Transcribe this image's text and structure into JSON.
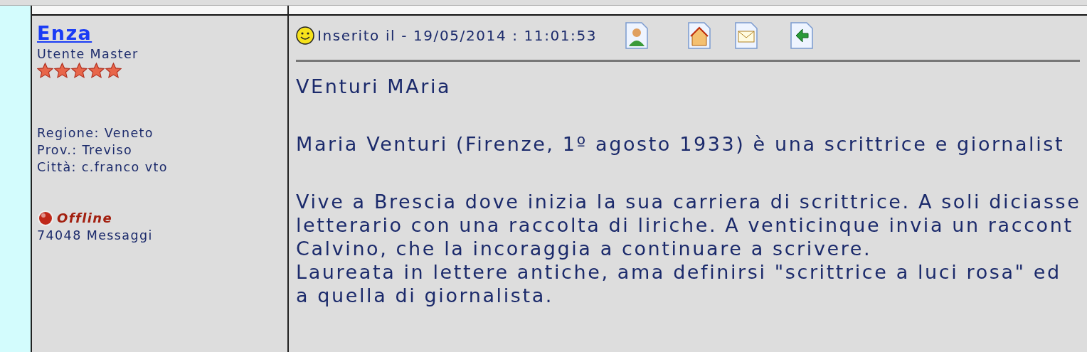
{
  "author": {
    "name": "Enza",
    "rank": "Utente Master",
    "stars": 5,
    "region": "Regione: Veneto",
    "province": "Prov.: Treviso",
    "city": "Città: c.franco vto",
    "status": {
      "label": "Offline",
      "online": false
    },
    "posts": "74048 Messaggi"
  },
  "post": {
    "posted": "Inserito il - 19/05/2014 : 11:01:53",
    "paragraphs": [
      [
        "VEnturi MAria"
      ],
      [
        "Maria Venturi (Firenze, 1º agosto 1933) è una scrittrice e giornalist"
      ],
      [
        "Vive a Brescia dove inizia la sua carriera di scrittrice. A soli diciasse",
        "letterario con una raccolta di liriche. A venticinque invia un raccont",
        "Calvino, che la incoraggia a continuare a scrivere.",
        "Laureata in lettere antiche, ama definirsi \"scrittrice a luci rosa\" ed",
        "a quella di giornalista."
      ]
    ]
  }
}
